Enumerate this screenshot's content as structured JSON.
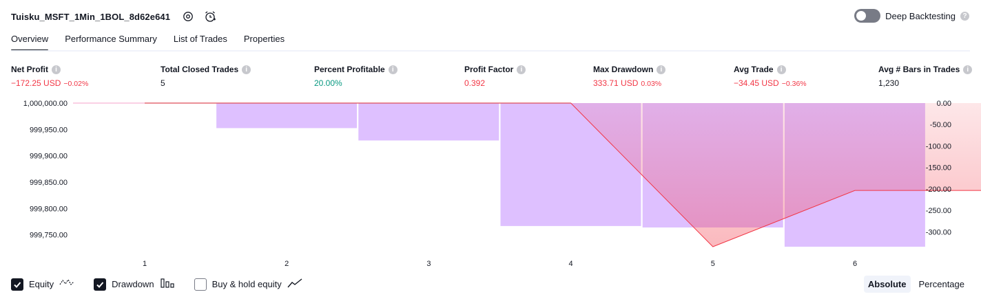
{
  "header": {
    "title": "Tuisku_MSFT_1Min_1BOL_8d62e641",
    "settings_icon": "gear-icon",
    "alert_icon": "alarm-clock-icon",
    "deep_backtesting_label": "Deep Backtesting",
    "deep_backtesting_enabled": false
  },
  "tabs": [
    {
      "label": "Overview",
      "active": true
    },
    {
      "label": "Performance Summary",
      "active": false
    },
    {
      "label": "List of Trades",
      "active": false
    },
    {
      "label": "Properties",
      "active": false
    }
  ],
  "metrics": [
    {
      "label": "Net Profit",
      "value": "−172.25 USD",
      "pct": "−0.02%",
      "tone": "neg"
    },
    {
      "label": "Total Closed Trades",
      "value": "5",
      "pct": "",
      "tone": ""
    },
    {
      "label": "Percent Profitable",
      "value": "20.00%",
      "pct": "",
      "tone": "pos"
    },
    {
      "label": "Profit Factor",
      "value": "0.392",
      "pct": "",
      "tone": "neg"
    },
    {
      "label": "Max Drawdown",
      "value": "333.71 USD",
      "pct": "0.03%",
      "tone": "neg"
    },
    {
      "label": "Avg Trade",
      "value": "−34.45 USD",
      "pct": "−0.36%",
      "tone": "neg"
    },
    {
      "label": "Avg # Bars in Trades",
      "value": "1,230",
      "pct": "",
      "tone": ""
    }
  ],
  "colors": {
    "equity_line": "#f23645",
    "equity_fill": "#f23645",
    "drawdown_bar": "#d1a7ff",
    "axis_line": "#787b86",
    "negative": "#f23645",
    "positive": "#089981"
  },
  "chart_data": {
    "type": "line",
    "x": [
      0,
      1,
      2,
      3,
      4,
      5,
      6
    ],
    "x_tick_labels": [
      "1",
      "2",
      "3",
      "4",
      "5",
      "6"
    ],
    "series": [
      {
        "name": "Equity",
        "values": [
          1000000,
          1000000,
          1000000,
          1000000,
          999727.5,
          999834.2,
          999834.2
        ],
        "axis": "left"
      },
      {
        "name": "Drawdown",
        "values": [
          0,
          -0.02,
          -58.3,
          -87.1,
          -286.3,
          -289.7,
          -334.5
        ],
        "axis": "right",
        "style": "bar"
      }
    ],
    "left_axis": {
      "ticks": [
        1000000.0,
        999950.0,
        999900.0,
        999850.0,
        999800.0,
        999750.0
      ],
      "tick_labels": [
        "1,000,000.00",
        "999,950.00",
        "999,900.00",
        "999,850.00",
        "999,800.00",
        "999,750.00"
      ],
      "ylim": [
        999727.5,
        1000000
      ]
    },
    "right_axis": {
      "ticks": [
        0,
        -50,
        -100,
        -150,
        -200,
        -250,
        -300
      ],
      "tick_labels": [
        "0.00",
        "-50.00",
        "-100.00",
        "-150.00",
        "-200.00",
        "-250.00",
        "-300.00"
      ],
      "ylim": [
        -334.5,
        0
      ]
    },
    "grid": false
  },
  "legend": [
    {
      "label": "Equity",
      "checked": true,
      "icon": "equity-line-icon"
    },
    {
      "label": "Drawdown",
      "checked": true,
      "icon": "drawdown-bars-icon"
    },
    {
      "label": "Buy & hold equity",
      "checked": false,
      "icon": "buy-hold-line-icon"
    }
  ],
  "view_modes": [
    {
      "label": "Absolute",
      "active": true
    },
    {
      "label": "Percentage",
      "active": false
    }
  ]
}
